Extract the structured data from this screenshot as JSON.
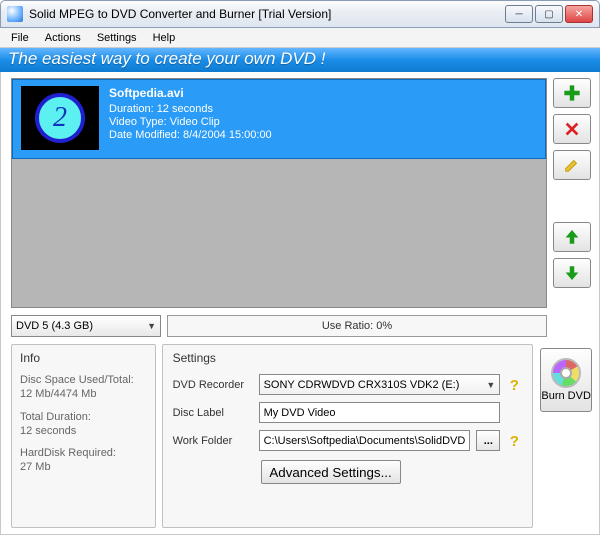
{
  "window": {
    "title": "Solid MPEG to DVD Converter and Burner [Trial Version]"
  },
  "menu": {
    "file": "File",
    "actions": "Actions",
    "settings": "Settings",
    "help": "Help"
  },
  "banner": "The easiest way to create your own DVD !",
  "file": {
    "thumb_text": "2",
    "name": "Softpedia.avi",
    "duration": "Duration: 12 seconds",
    "vtype": "Video Type: Video Clip",
    "modified": "Date Modified: 8/4/2004 15:00:00"
  },
  "disc": {
    "selected": "DVD 5   (4.3 GB)"
  },
  "ratio": "Use Ratio: 0%",
  "info": {
    "title": "Info",
    "space_label": "Disc Space Used/Total:",
    "space_value": "12 Mb/4474 Mb",
    "dur_label": "Total Duration:",
    "dur_value": "12 seconds",
    "hd_label": "HardDisk Required:",
    "hd_value": "27 Mb"
  },
  "settings": {
    "title": "Settings",
    "recorder_label": "DVD Recorder",
    "recorder_value": "SONY CDRWDVD CRX310S VDK2 (E:)",
    "disclabel_label": "Disc Label",
    "disclabel_value": "My DVD Video",
    "workfolder_label": "Work Folder",
    "workfolder_value": "C:\\Users\\Softpedia\\Documents\\SolidDVD",
    "browse": "...",
    "advanced": "Advanced Settings..."
  },
  "burn": {
    "label": "Burn DVD"
  }
}
